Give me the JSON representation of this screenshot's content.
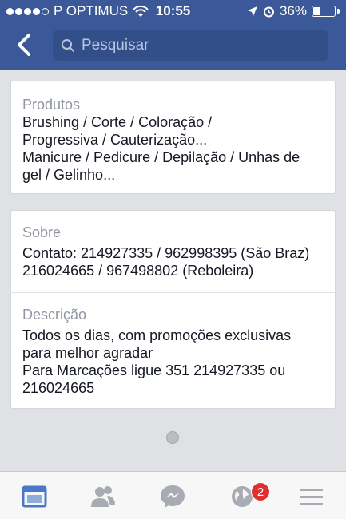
{
  "status_bar": {
    "carrier": "P OPTIMUS",
    "time": "10:55",
    "battery": "36%",
    "battery_level": 0.36,
    "signal_bars_filled": 4
  },
  "header": {
    "search_placeholder": "Pesquisar",
    "back_icon": "chevron-left-icon",
    "search_icon": "search-icon",
    "background_color": "#3b5998"
  },
  "products": {
    "label": "Produtos",
    "line1": "Brushing / Corte / Coloração /",
    "line2": "Progressiva / Cauterização...",
    "line3": "Manicure / Pedicure / Depilação / Unhas de",
    "line4": "gel / Gelinho..."
  },
  "about": {
    "label": "Sobre",
    "line1": "Contato: 214927335 / 962998395 (São Braz)",
    "line2": " 216024665 / 967498802 (Reboleira)"
  },
  "description": {
    "label": "Descrição",
    "line1": "Todos os dias, com promoções exclusivas",
    "line2": "para melhor agradar",
    "line3": "Para Marcações ligue 351 214927335 ou",
    "line4": "216024665"
  },
  "tabbar": {
    "tabs": [
      {
        "icon": "news-feed-icon",
        "active": true
      },
      {
        "icon": "friend-requests-icon",
        "active": false
      },
      {
        "icon": "messenger-icon",
        "active": false
      },
      {
        "icon": "notifications-globe-icon",
        "active": false
      },
      {
        "icon": "menu-icon",
        "active": false
      }
    ],
    "notifications_badge": "2",
    "active_color": "#4a7ac7",
    "inactive_color": "#a8abb2"
  }
}
